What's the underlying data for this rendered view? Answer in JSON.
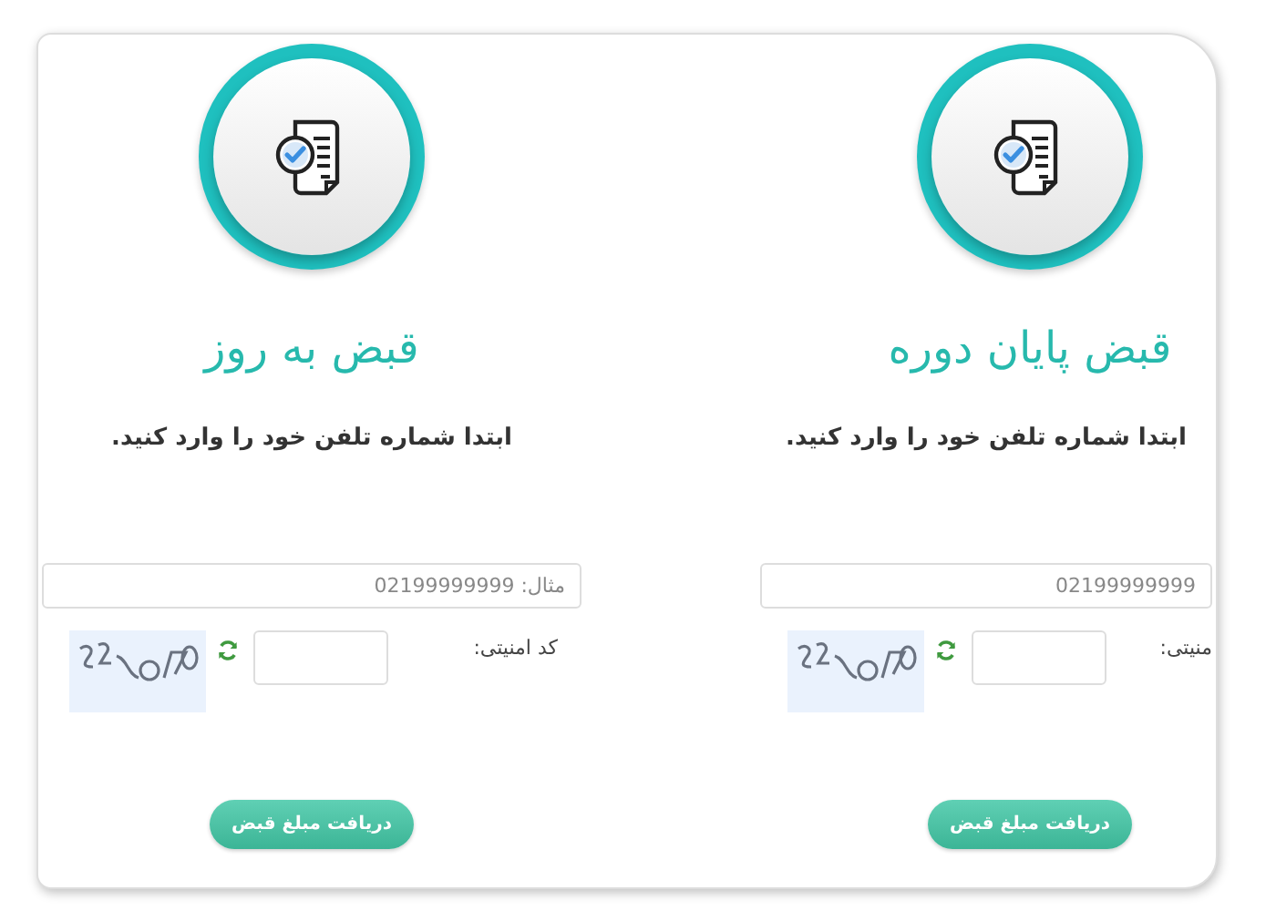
{
  "panels": [
    {
      "title": "قبض پایان دوره",
      "instruction": "ابتدا شماره تلفن خود را وارد کنید.",
      "phone_field": {
        "placeholder": "02199999999"
      },
      "security_label": "منیتی:",
      "submit_button": "دریافت مبلغ قبض"
    },
    {
      "title": "قبض به روز",
      "instruction": "ابتدا شماره تلفن خود را وارد کنید.",
      "phone_field": {
        "placeholder": "مثال: 02199999999"
      },
      "security_label": "کد امنیتی:",
      "submit_button": "دریافت مبلغ قبض"
    }
  ]
}
